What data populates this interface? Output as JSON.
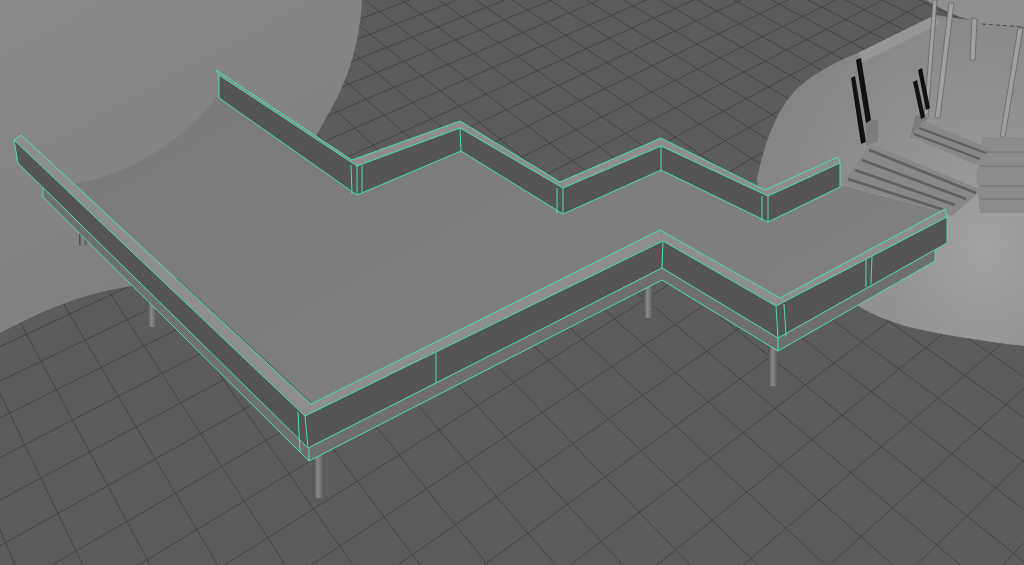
{
  "viewport": {
    "show_grid": true,
    "objects": [
      {
        "kind": "terrain",
        "selected": false
      },
      {
        "kind": "gazebo",
        "selected": false
      },
      {
        "kind": "deck",
        "selected": true
      }
    ]
  }
}
